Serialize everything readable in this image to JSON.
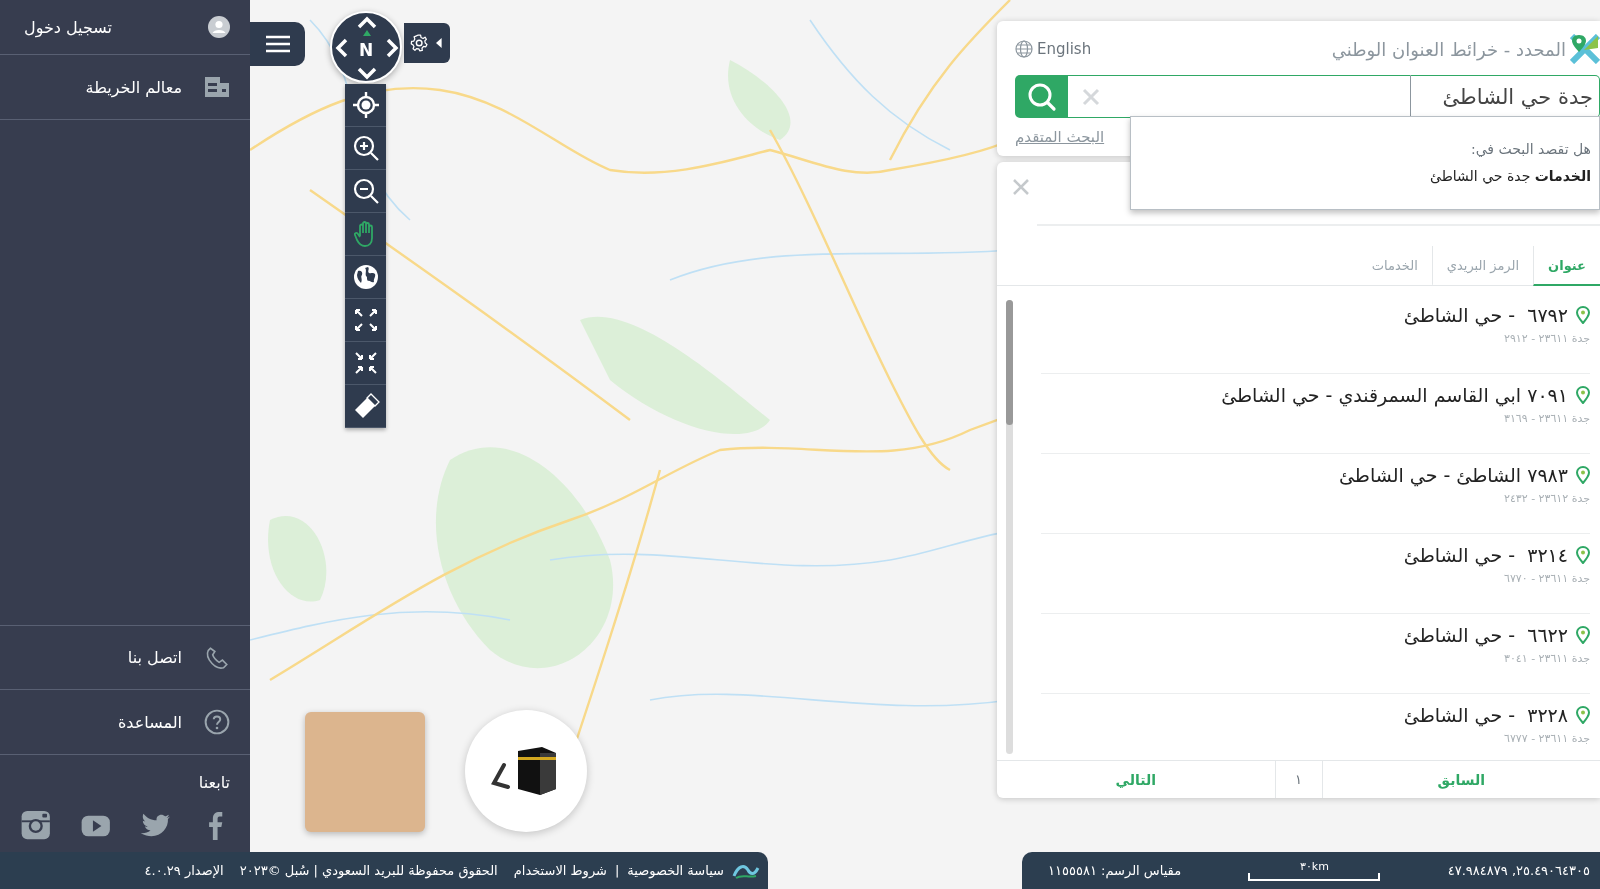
{
  "sidebar": {
    "login": {
      "label": "تسجيل دخول"
    },
    "items": [
      {
        "label": "معالم الخريطة",
        "kind": "layers"
      }
    ],
    "bottom_items": [
      {
        "label": "اتصل بنا",
        "kind": "phone"
      },
      {
        "label": "المساعدة",
        "kind": "help"
      }
    ],
    "follow": {
      "label": "تابعنا",
      "social": [
        {
          "kind": "facebook"
        },
        {
          "kind": "twitter"
        },
        {
          "kind": "youtube"
        },
        {
          "kind": "instagram"
        }
      ]
    }
  },
  "map_controls": {
    "compass_label": "N",
    "tools": [
      {
        "kind": "locate",
        "selected": false
      },
      {
        "kind": "zoom_in",
        "selected": false
      },
      {
        "kind": "zoom_out",
        "selected": false
      },
      {
        "kind": "pan",
        "selected": true
      },
      {
        "kind": "globe",
        "selected": false
      },
      {
        "kind": "expand",
        "selected": false
      },
      {
        "kind": "collapse",
        "selected": false
      },
      {
        "kind": "eraser",
        "selected": false
      }
    ]
  },
  "search_panel": {
    "title": "المحدد - خرائط العنوان الوطني",
    "language": "English",
    "search_value": "جدة حي الشاطئ",
    "advanced_link": "البحث المتقدم",
    "suggestions": {
      "prompt": "هل تقصد البحث في:",
      "items": [
        "**الخدمات** جدة حي الشاطئ"
      ]
    },
    "tabs": [
      {
        "label": "عنوان",
        "selected": true
      },
      {
        "label": "الرمز البريدي",
        "selected": false
      },
      {
        "label": "الخدمات",
        "selected": false
      }
    ],
    "results": [
      {
        "title": "٦٧٩٢  - حي الشاطئ",
        "subtitle": "جدة ٢٣٦١١ - ٢٩١٢"
      },
      {
        "title": "٧٠٩١ ابي القاسم السمرقندي - حي الشاطئ",
        "subtitle": "جدة ٢٣٦١١ - ٣١٦٩"
      },
      {
        "title": "٧٩٨٣ الشاطئ - حي الشاطئ",
        "subtitle": "جدة ٢٣٦١٢ - ٢٤٣٢"
      },
      {
        "title": "٣٢١٤  - حي الشاطئ",
        "subtitle": "جدة ٢٣٦١١ - ٦٧٧٠"
      },
      {
        "title": "٦٦٢٢  - حي الشاطئ",
        "subtitle": "جدة ٢٣٦١١ - ٣٠٤١"
      },
      {
        "title": "٣٢٢٨  - حي الشاطئ",
        "subtitle": "جدة ٢٣٦١١ - ٦٧٧٧"
      }
    ],
    "pagination": {
      "previous": "السابق",
      "page": "١",
      "next": "التالي"
    }
  },
  "footer": {
    "links": [
      "سياسة الخصوصية",
      "شروط الاستخدام"
    ],
    "separator": "|",
    "copyright": "الحقوق محفوظة للبريد السعودي | سُبل ©٢٠٢٣",
    "version": "الإصدار ٤.٠.٢٩"
  },
  "status": {
    "coordinates": "٢٥.٤٩٠٦٤٣٠٥, ٤٧.٩٨٤٨٧٩",
    "scale_bar": "٣٠km",
    "scale_label": "مقياس الرسم: ١١٥٥٥٨١"
  }
}
